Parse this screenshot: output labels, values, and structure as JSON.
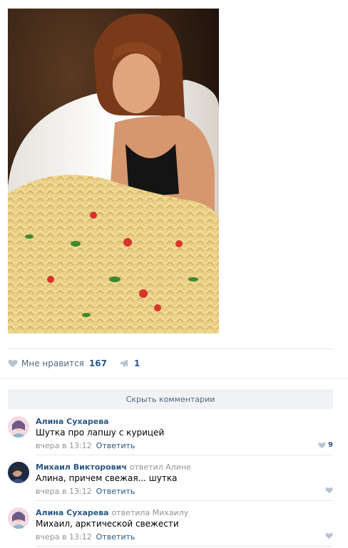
{
  "post": {
    "photo_alt": "",
    "likes": {
      "label": "Мне нравится",
      "count": "167"
    },
    "shares": {
      "count": "1"
    }
  },
  "comments_section": {
    "hide_label": "Скрыть комментарии",
    "items": [
      {
        "author": "Алина Сухарева",
        "reply_to": "",
        "text": "Шутка про лапшу с курицей",
        "time": "вчера в 13:12",
        "reply_label": "Ответить",
        "likes": "9"
      },
      {
        "author": "Михаил Викторович",
        "reply_to": "ответил Алине",
        "text": "Алина, причем свежая... шутка",
        "time": "вчера в 13:12",
        "reply_label": "Ответить",
        "likes": ""
      },
      {
        "author": "Алина Сухарева",
        "reply_to": "ответила Михаилу",
        "text": "Михаил, арктической свежести",
        "time": "вчера в 13:12",
        "reply_label": "Ответить",
        "likes": ""
      }
    ]
  },
  "icons": {
    "like": "heart-icon",
    "share": "megaphone-icon"
  },
  "colors": {
    "link": "#2a5885",
    "muted": "#939393",
    "divider": "#e7e8ec",
    "button_bg": "#f0f2f5"
  }
}
